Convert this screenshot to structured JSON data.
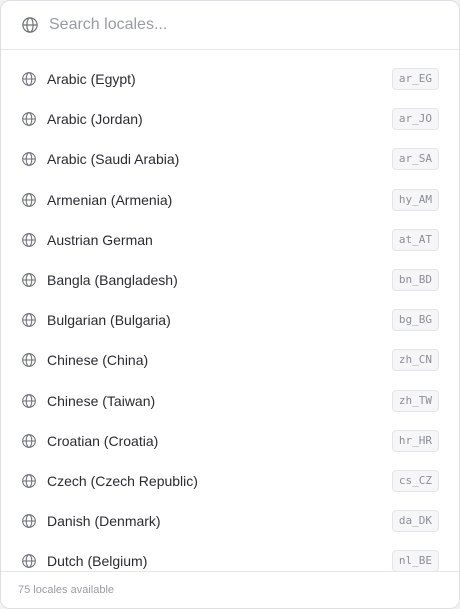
{
  "search": {
    "placeholder": "Search locales...",
    "icon": "globe-icon"
  },
  "locales": [
    {
      "label": "Arabic (Egypt)",
      "code": "ar_EG"
    },
    {
      "label": "Arabic (Jordan)",
      "code": "ar_JO"
    },
    {
      "label": "Arabic (Saudi Arabia)",
      "code": "ar_SA"
    },
    {
      "label": "Armenian (Armenia)",
      "code": "hy_AM"
    },
    {
      "label": "Austrian German",
      "code": "at_AT"
    },
    {
      "label": "Bangla (Bangladesh)",
      "code": "bn_BD"
    },
    {
      "label": "Bulgarian (Bulgaria)",
      "code": "bg_BG"
    },
    {
      "label": "Chinese (China)",
      "code": "zh_CN"
    },
    {
      "label": "Chinese (Taiwan)",
      "code": "zh_TW"
    },
    {
      "label": "Croatian (Croatia)",
      "code": "hr_HR"
    },
    {
      "label": "Czech (Czech Republic)",
      "code": "cs_CZ"
    },
    {
      "label": "Danish (Denmark)",
      "code": "da_DK"
    },
    {
      "label": "Dutch (Belgium)",
      "code": "nl_BE"
    }
  ],
  "footer": {
    "status": "75 locales available"
  },
  "colors": {
    "text": "#2a2b30",
    "muted": "#9a9ca3",
    "border": "#e6e7ea",
    "badge_bg": "#f6f6f8"
  }
}
